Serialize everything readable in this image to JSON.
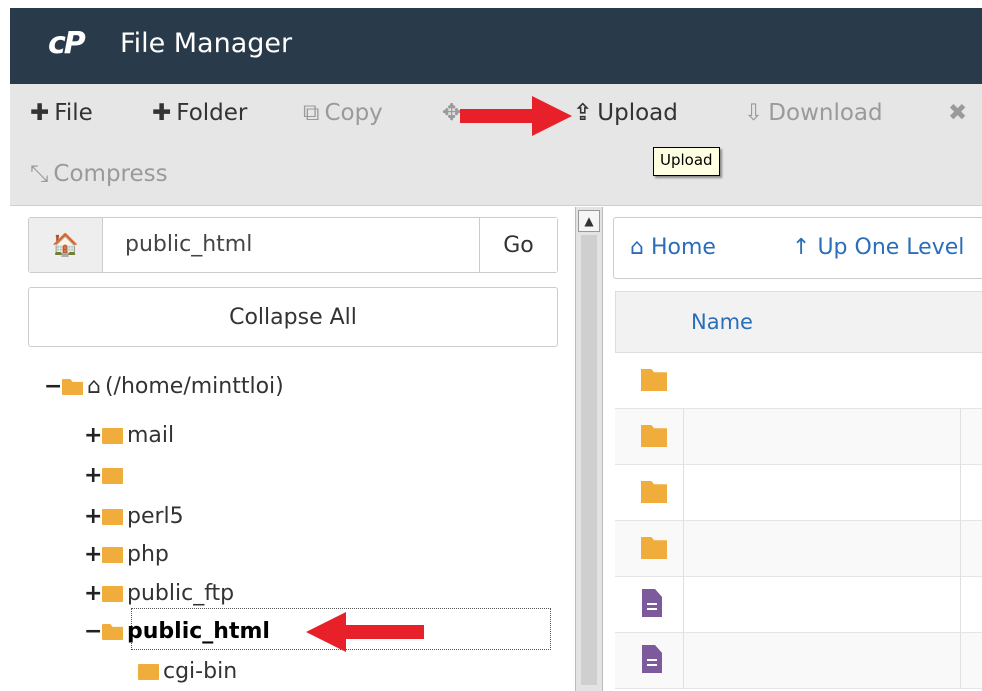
{
  "header": {
    "logo": "cP",
    "title": "File Manager"
  },
  "toolbar": {
    "file": "File",
    "folder": "Folder",
    "copy": "Copy",
    "upload": "Upload",
    "download": "Download",
    "compress": "Compress",
    "icons": [
      "plus-icon",
      "copy-icon",
      "move-icon",
      "upload-icon",
      "download-icon",
      "delete-icon",
      "compress-icon"
    ]
  },
  "tooltip": {
    "text": "Upload"
  },
  "left_pane": {
    "path_value": "public_html",
    "go_label": "Go",
    "collapse_label": "Collapse All",
    "tree": {
      "root": "(/home/minttloi)",
      "items": [
        {
          "toggle": "+",
          "label": "mail"
        },
        {
          "toggle": "+",
          "label": ""
        },
        {
          "toggle": "+",
          "label": "perl5"
        },
        {
          "toggle": "+",
          "label": "php"
        },
        {
          "toggle": "+",
          "label": "public_ftp"
        },
        {
          "toggle": "−",
          "label": "public_html",
          "selected": true
        },
        {
          "toggle": "",
          "label": "cgi-bin"
        }
      ],
      "root_toggle": "−"
    }
  },
  "right_pane": {
    "home_label": "Home",
    "up_label": "Up One Level",
    "column_name": "Name",
    "rows": [
      "folder",
      "folder",
      "folder",
      "folder",
      "document",
      "document"
    ]
  },
  "colors": {
    "header_bg": "#293a4a",
    "folder": "#f0ad3c",
    "link": "#2a6ebb",
    "arrow": "#e8202a"
  }
}
